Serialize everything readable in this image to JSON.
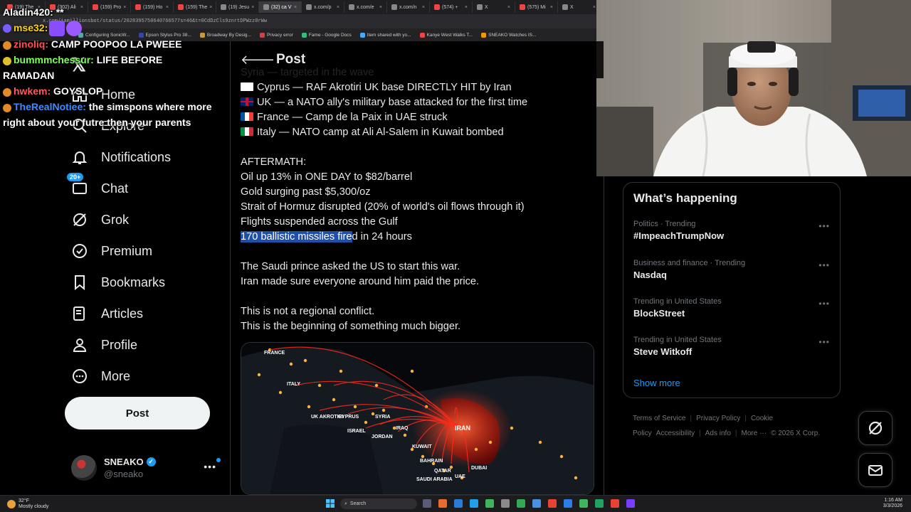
{
  "browser": {
    "tabs": [
      {
        "label": "(19) The"
      },
      {
        "label": "(302) Ali"
      },
      {
        "label": "(159) Pro"
      },
      {
        "label": "(159) Ho"
      },
      {
        "label": "(159) The"
      },
      {
        "label": "(19) Jesu"
      },
      {
        "label": "(32) ca V",
        "active": true
      },
      {
        "label": "x.com/p"
      },
      {
        "label": "x.com/e"
      },
      {
        "label": "x.com/n"
      },
      {
        "label": "(574) +"
      },
      {
        "label": "X"
      },
      {
        "label": "(575) Mi"
      },
      {
        "label": "X"
      }
    ],
    "url": "x.com/iamillionsbot/status/2028395750640766577s=46&t=0CdDzCls9znrtDPWzz0rWw",
    "bookmarks": [
      "Configuring SonicW...",
      "Epson Stylus Pro 38...",
      "Broadway By Desig...",
      "Privacy error",
      "Fame - Google Docs",
      "Item shared with yo...",
      "Kanye West Walks T...",
      "SNEAKO Watches IS..."
    ]
  },
  "chat": {
    "messages": [
      {
        "user": "Aladin420:",
        "text": " **",
        "user_color": "#ffffff"
      },
      {
        "user": "mse32:",
        "text": "",
        "user_color": "#ffd400"
      },
      {
        "user": "zinoliq:",
        "text": " CAMP POOPOO LA PWEEE",
        "user_color": "#ff4f4f"
      },
      {
        "user": "bummmchessur:",
        "text": " LIFE BEFORE RAMADAN",
        "user_color": "#7fff5a"
      },
      {
        "user": "hwkem:",
        "text": " GOYSLOP",
        "user_color": "#ff5a5a"
      },
      {
        "user": "TheRealNotiee:",
        "text": " the simspons where more right about your futre then your parents",
        "user_color": "#3d8bff"
      }
    ]
  },
  "sidebar": {
    "items": [
      {
        "label": "Home",
        "icon": "home-icon"
      },
      {
        "label": "Explore",
        "icon": "search-icon"
      },
      {
        "label": "Notifications",
        "icon": "bell-icon"
      },
      {
        "label": "Chat",
        "icon": "chat-icon",
        "badge": "20+"
      },
      {
        "label": "Grok",
        "icon": "grok-icon"
      },
      {
        "label": "Premium",
        "icon": "premium-icon"
      },
      {
        "label": "Bookmarks",
        "icon": "bookmark-icon"
      },
      {
        "label": "Articles",
        "icon": "articles-icon"
      },
      {
        "label": "Profile",
        "icon": "profile-icon"
      },
      {
        "label": "More",
        "icon": "more-circle-icon"
      }
    ],
    "post_button": "Post",
    "profile": {
      "name": "SNEAKO",
      "handle": "@sneako"
    }
  },
  "main": {
    "header_title": "Post",
    "lines": [
      {
        "flag": "",
        "text": "Syria — targeted in the wave"
      },
      {
        "flag": "cyprus",
        "text": "Cyprus — RAF Akrotiri UK base DIRECTLY HIT by Iran"
      },
      {
        "flag": "uk",
        "text": "UK — a NATO ally's military base attacked for the first time"
      },
      {
        "flag": "france",
        "text": "France — Camp de la Paix in UAE struck"
      },
      {
        "flag": "italy",
        "text": "Italy — NATO camp at Ali Al-Salem in Kuwait bombed"
      },
      {
        "flag": "",
        "text": ""
      },
      {
        "flag": "",
        "text": "AFTERMATH:"
      },
      {
        "flag": "",
        "text": "Oil up 13% in ONE DAY to $82/barrel"
      },
      {
        "flag": "",
        "text": "Gold surging past $5,300/oz"
      },
      {
        "flag": "",
        "text": "Strait of Hormuz disrupted (20% of world's oil flows through it)"
      },
      {
        "flag": "",
        "text": "Flights suspended across the Gulf"
      },
      {
        "flag": "",
        "text": "170 ballistic missiles fired in 24 hours",
        "highlight": "170 ballistic missiles fire",
        "rest": "d in 24 hours"
      },
      {
        "flag": "",
        "text": ""
      },
      {
        "flag": "",
        "text": "The Saudi prince asked the US to start this war."
      },
      {
        "flag": "",
        "text": "Iran made sure everyone around him paid the price."
      },
      {
        "flag": "",
        "text": ""
      },
      {
        "flag": "",
        "text": "This is not a regional conflict."
      },
      {
        "flag": "",
        "text": "This is the beginning of something much bigger."
      }
    ],
    "map_labels": [
      "FRANCE",
      "ITALY",
      "UK AKROTIRI",
      "CYPRUS",
      "SYRIA",
      "ISRAEL",
      "JORDAN",
      "IRAQ",
      "IRAN",
      "KUWAIT",
      "BAHRAIN",
      "QATAR",
      "DUBAI",
      "UAE",
      "SAUDI ARABIA"
    ]
  },
  "trends": {
    "title": "What’s happening",
    "items": [
      {
        "meta": "Politics · Trending",
        "name": "#ImpeachTrumpNow"
      },
      {
        "meta": "Business and finance · Trending",
        "name": "Nasdaq"
      },
      {
        "meta": "Trending in United States",
        "name": "BlockStreet"
      },
      {
        "meta": "Trending in United States",
        "name": "Steve Witkoff"
      }
    ],
    "show_more": "Show more"
  },
  "footer": {
    "links": [
      "Terms of Service",
      "Privacy Policy",
      "Cookie Policy",
      "Accessibility",
      "Ads info",
      "More ···",
      "© 2026 X Corp."
    ]
  },
  "taskbar": {
    "weather_temp": "32°F",
    "weather_desc": "Mostly cloudy",
    "search_placeholder": "Search",
    "time": "1:16 AM",
    "date": "3/3/2026"
  },
  "colors": {
    "accent": "#1d9bf0",
    "highlight": "#1f4fa8",
    "missile_red": "#ff2a1a"
  }
}
